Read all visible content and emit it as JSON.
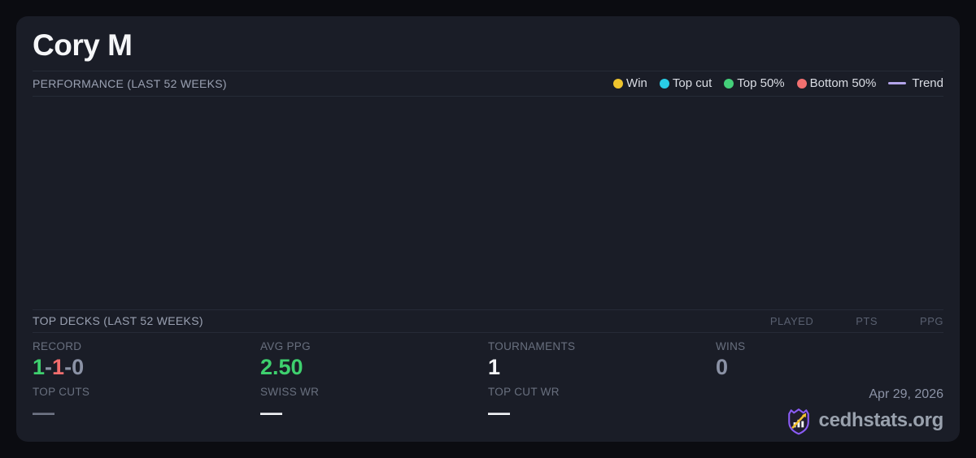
{
  "player": {
    "name": "Cory M"
  },
  "performance": {
    "title": "PERFORMANCE (LAST 52 WEEKS)",
    "legend": [
      {
        "label": "Win",
        "swatch": "dot",
        "color": "#eec42d"
      },
      {
        "label": "Top cut",
        "swatch": "dot",
        "color": "#29cde6"
      },
      {
        "label": "Top 50%",
        "swatch": "dot",
        "color": "#44cf79"
      },
      {
        "label": "Bottom 50%",
        "swatch": "dot",
        "color": "#f17070"
      },
      {
        "label": "Trend",
        "swatch": "line",
        "color": "#b3a4ea"
      }
    ],
    "chart_points": []
  },
  "top_decks": {
    "title": "TOP DECKS (LAST 52 WEEKS)",
    "columns": [
      "PLAYED",
      "PTS",
      "PPG"
    ],
    "rows": []
  },
  "stats": {
    "record": {
      "label": "RECORD",
      "wins": "1",
      "losses": "1",
      "draws": "0",
      "sep": "-"
    },
    "avg_ppg": {
      "label": "AVG PPG",
      "value": "2.50"
    },
    "tournaments": {
      "label": "TOURNAMENTS",
      "value": "1"
    },
    "wins": {
      "label": "WINS",
      "value": "0"
    },
    "top_cuts": {
      "label": "TOP CUTS",
      "value": "—"
    },
    "swiss_wr": {
      "label": "SWISS WR",
      "value": "—"
    },
    "top_cut_wr": {
      "label": "TOP CUT WR",
      "value": "—"
    }
  },
  "footer": {
    "date": "Apr 29, 2026",
    "brand": "cedhstats.org"
  },
  "colors": {
    "bg": "#0b0c11",
    "card": "#1a1d27",
    "divider": "#262b37",
    "heading": "#9aa1b2",
    "label": "#69707f",
    "colhead": "#596070",
    "legend_text": "#dadde4",
    "legend_yellow": "#eec42d",
    "legend_cyan": "#29cde6",
    "legend_green": "#44cf79",
    "legend_red": "#f17070",
    "legend_purple": "#b3a4ea",
    "win_green": "#3ed06e",
    "loss_red": "#f26d6d",
    "muted_value": "#8b92a5",
    "muted_dash": "#6f7585",
    "brand_gray": "#99a1ad",
    "logo_purple": "#8b5cf6",
    "logo_gold": "#f2c12e"
  }
}
